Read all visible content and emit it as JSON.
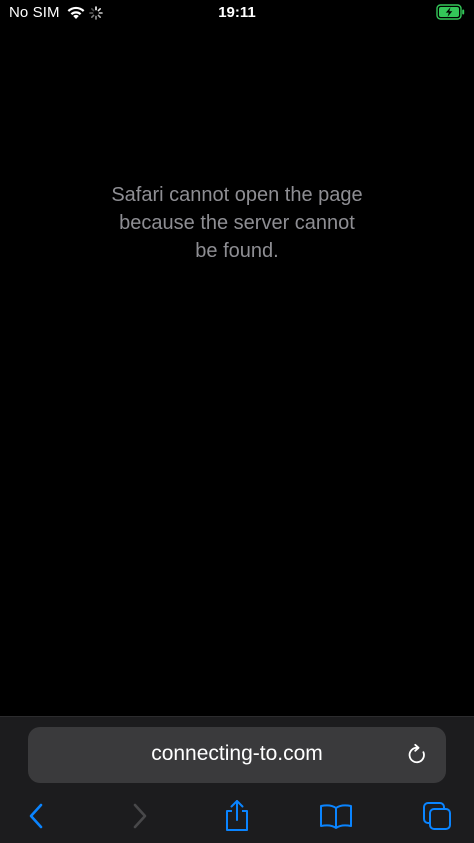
{
  "status_bar": {
    "carrier": "No SIM",
    "time": "19:11",
    "icons": [
      "wifi-icon",
      "activity-spinner-icon",
      "battery-charging-icon"
    ],
    "battery_color": "#34c759"
  },
  "page": {
    "error_message": "Safari cannot open the page\nbecause the server cannot\nbe found."
  },
  "address_bar": {
    "url": "connecting-to.com",
    "icon": "reload-icon"
  },
  "toolbar": {
    "items": [
      "back-icon",
      "forward-icon",
      "share-icon",
      "bookmarks-icon",
      "tabs-icon"
    ],
    "accent_color": "#0a84ff",
    "disabled_color": "#48484a"
  }
}
